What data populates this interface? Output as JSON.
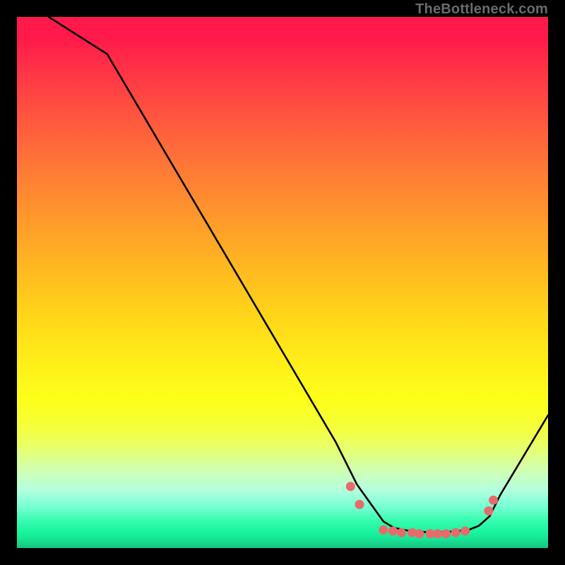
{
  "credit": "TheBottleneck.com",
  "chart_data": {
    "type": "line",
    "title": "",
    "xlabel": "",
    "ylabel": "",
    "xlim": [
      0,
      100
    ],
    "ylim": [
      0,
      100
    ],
    "grid": false,
    "series": [
      {
        "name": "bottleneck-curve",
        "x": [
          6,
          17,
          60,
          64,
          69,
          71,
          74,
          77,
          80,
          82,
          85,
          87,
          89,
          91,
          100
        ],
        "values": [
          100,
          93,
          20,
          12,
          5,
          3.8,
          3.2,
          3.0,
          3.0,
          3.1,
          3.4,
          4.2,
          6,
          10,
          25
        ],
        "color": "#000000"
      }
    ],
    "markers": {
      "name": "bottom-dots",
      "color": "#e86a6a",
      "points": [
        {
          "x": 62.8,
          "y": 11.6
        },
        {
          "x": 64.5,
          "y": 8.2
        },
        {
          "x": 69.0,
          "y": 3.4
        },
        {
          "x": 70.8,
          "y": 3.2
        },
        {
          "x": 72.4,
          "y": 2.9
        },
        {
          "x": 74.4,
          "y": 2.9
        },
        {
          "x": 75.8,
          "y": 2.7
        },
        {
          "x": 77.8,
          "y": 2.7
        },
        {
          "x": 79.2,
          "y": 2.7
        },
        {
          "x": 80.8,
          "y": 2.7
        },
        {
          "x": 82.6,
          "y": 2.9
        },
        {
          "x": 84.4,
          "y": 3.2
        },
        {
          "x": 88.8,
          "y": 7.0
        },
        {
          "x": 89.7,
          "y": 9.0
        }
      ]
    },
    "background_gradient": {
      "top": "#ff1a4b",
      "mid": "#ffd31a",
      "bottom": "#14c480"
    }
  }
}
